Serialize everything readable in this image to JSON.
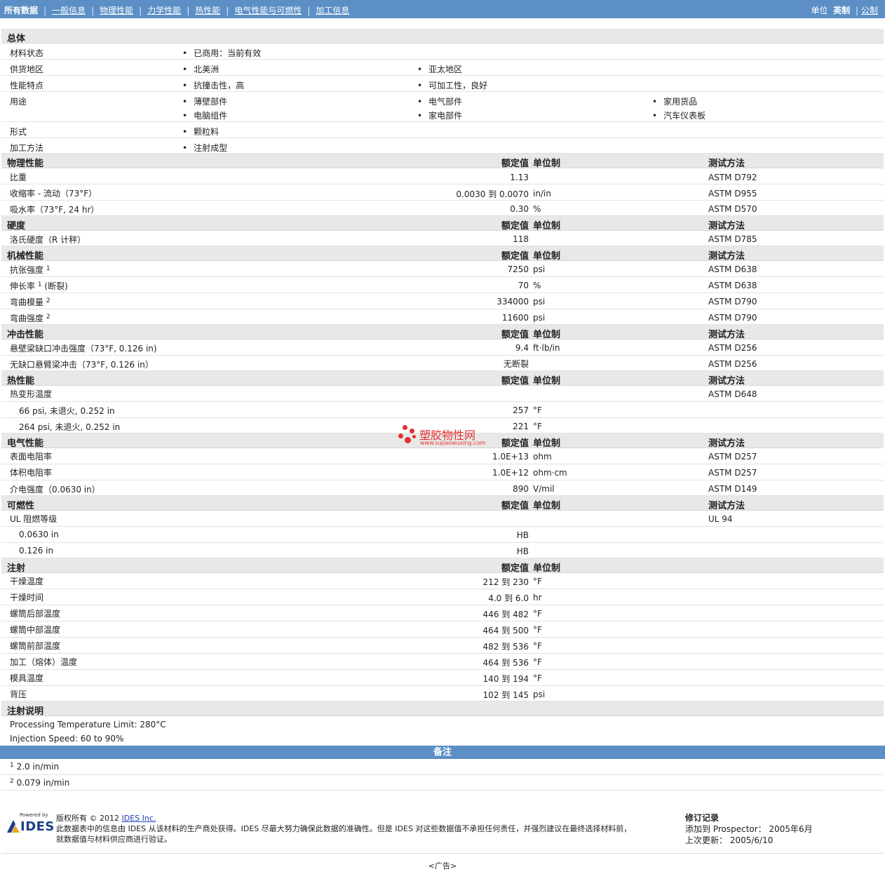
{
  "nav": {
    "items": [
      "所有数据",
      "一般信息",
      "物理性能",
      "力学性能",
      "热性能",
      "电气性能与可燃性",
      "加工信息"
    ],
    "units_label": "单位",
    "unit_english": "英制",
    "unit_metric": "公制"
  },
  "general": {
    "title": "总体",
    "status_label": "材料状态",
    "status_value": "已商用：当前有效",
    "region_label": "供货地区",
    "region_1": "北美洲",
    "region_2": "亚太地区",
    "features_label": "性能特点",
    "feature_1": "抗撞击性，高",
    "feature_2": "可加工性，良好",
    "uses_label": "用途",
    "uses": [
      "薄壁部件",
      "电气部件",
      "家用货品",
      "电脑组件",
      "家电部件",
      "汽车仪表板"
    ],
    "form_label": "形式",
    "form_value": "颗粒料",
    "method_label": "加工方法",
    "method_value": "注射成型"
  },
  "col_headers": {
    "nominal": "额定值",
    "unit": "单位制",
    "method": "测试方法"
  },
  "physical": {
    "title": "物理性能",
    "rows": [
      {
        "label": "比重",
        "value": "1.13",
        "unit": "",
        "method": "ASTM D792"
      },
      {
        "label": "收缩率 - 流动（73°F）",
        "value": "0.0030 到  0.0070",
        "unit": "in/in",
        "method": "ASTM D955"
      },
      {
        "label": "吸水率（73°F, 24 hr）",
        "value": "0.30",
        "unit": "%",
        "method": "ASTM D570"
      }
    ]
  },
  "hardness": {
    "title": "硬度",
    "rows": [
      {
        "label": "洛氏硬度（R 计秤）",
        "value": "118",
        "unit": "",
        "method": "ASTM D785"
      }
    ]
  },
  "mechanical": {
    "title": "机械性能",
    "rows": [
      {
        "label": "抗张强度",
        "sup": "1",
        "value": "7250",
        "unit": "psi",
        "method": "ASTM D638"
      },
      {
        "label": "伸长率",
        "sup": "1",
        "label_suffix": "(断裂)",
        "value": "70",
        "unit": "%",
        "method": "ASTM D638"
      },
      {
        "label": "弯曲模量",
        "sup": "2",
        "value": "334000",
        "unit": "psi",
        "method": "ASTM D790"
      },
      {
        "label": "弯曲强度",
        "sup": "2",
        "value": "11600",
        "unit": "psi",
        "method": "ASTM D790"
      }
    ]
  },
  "impact": {
    "title": "冲击性能",
    "rows": [
      {
        "label": "悬壁梁缺口冲击强度（73°F, 0.126 in)",
        "value": "9.4",
        "unit": "ft·lb/in",
        "method": "ASTM D256"
      },
      {
        "label": "无缺口悬臂梁冲击（73°F, 0.126 in）",
        "value": "无断裂",
        "unit": "",
        "method": "ASTM D256"
      }
    ]
  },
  "thermal": {
    "title": "热性能",
    "hdt_label": "热变形温度",
    "hdt_method": "ASTM D648",
    "rows": [
      {
        "label": "66 psi, 未退火, 0.252 in",
        "value": "257",
        "unit": "°F"
      },
      {
        "label": "264 psi, 未退火, 0.252 in",
        "value": "221",
        "unit": "°F"
      }
    ]
  },
  "electrical": {
    "title": "电气性能",
    "rows": [
      {
        "label": "表面电阻率",
        "value": "1.0E+13",
        "unit": "ohm",
        "method": "ASTM D257"
      },
      {
        "label": "体积电阻率",
        "value": "1.0E+12",
        "unit": "ohm·cm",
        "method": "ASTM D257"
      },
      {
        "label": "介电强度（0.0630 in）",
        "value": "890",
        "unit": "V/mil",
        "method": "ASTM D149"
      }
    ]
  },
  "flammability": {
    "title": "可燃性",
    "ul_label": "UL 阻燃等级",
    "ul_method": "UL 94",
    "rows": [
      {
        "label": "0.0630 in",
        "value": "HB"
      },
      {
        "label": "0.126 in",
        "value": "HB"
      }
    ]
  },
  "injection": {
    "title": "注射",
    "rows": [
      {
        "label": "干燥温度",
        "value": "212 到  230",
        "unit": "°F"
      },
      {
        "label": "干燥时间",
        "value": "4.0 到  6.0",
        "unit": "hr"
      },
      {
        "label": "螺筒后部温度",
        "value": "446 到  482",
        "unit": "°F"
      },
      {
        "label": "螺筒中部温度",
        "value": "464 到  500",
        "unit": "°F"
      },
      {
        "label": "螺筒前部温度",
        "value": "482 到  536",
        "unit": "°F"
      },
      {
        "label": "加工（熔体）温度",
        "value": "464 到  536",
        "unit": "°F"
      },
      {
        "label": "模具温度",
        "value": "140 到  194",
        "unit": "°F"
      },
      {
        "label": "背压",
        "value": "102 到  145",
        "unit": "psi"
      }
    ]
  },
  "injection_notes": {
    "title": "注射说明",
    "line_1": "Processing Temperature Limit: 280°C",
    "line_2": "Injection Speed: 60 to 90%"
  },
  "notes": {
    "title": "备注",
    "items": [
      {
        "num": "1",
        "text": "2.0 in/min"
      },
      {
        "num": "2",
        "text": "0.079 in/min"
      }
    ]
  },
  "footer": {
    "logo_powered": "Powered by",
    "logo_text": "IDES",
    "copyright_prefix": "版权所有 © 2012",
    "company_link": "IDES Inc.",
    "disclaimer_1": "此数据表中的信息由 IDES 从该材料的生产商处获得。IDES 尽最大努力确保此数据的准确性。但是 IDES 对这些数据值不承担任何责任，并强烈建议在最终选择材料前，",
    "disclaimer_2": "就数据值与材料供应商进行验证。",
    "revision_title": "修订记录",
    "added_line": "添加到 Prospector： 2005年6月",
    "updated_line": "上次更新： 2005/6/10",
    "ad_text": "<广告>"
  },
  "watermark": {
    "cn": "塑胶物性网",
    "url": "www.sujiaowuxing.com"
  },
  "colors": {
    "bar": "#5b8fc5",
    "section_bg": "#e8e8e8",
    "link": "#1a3fb5",
    "watermark": "#e53030"
  }
}
